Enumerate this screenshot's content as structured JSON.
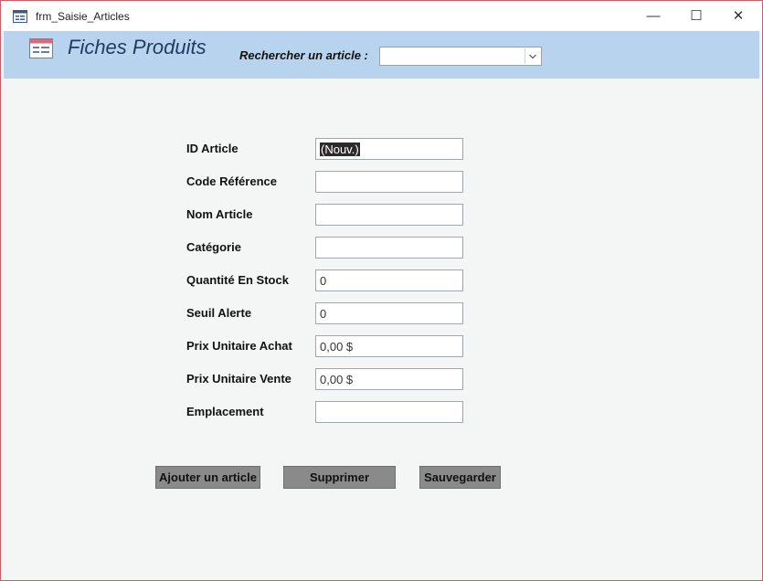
{
  "window": {
    "title": "frm_Saisie_Articles",
    "controls": {
      "minimize": "—",
      "maximize": "☐",
      "close": "✕"
    }
  },
  "header": {
    "title": "Fiches Produits",
    "search_label": "Rechercher un article :",
    "search_value": "",
    "background": "#b8d3ee"
  },
  "fields": [
    {
      "label": "ID Article",
      "value": "(Nouv.)",
      "selected": true
    },
    {
      "label": "Code Référence",
      "value": ""
    },
    {
      "label": "Nom Article",
      "value": ""
    },
    {
      "label": "Catégorie",
      "value": ""
    },
    {
      "label": "Quantité En Stock",
      "value": "0"
    },
    {
      "label": "Seuil Alerte",
      "value": "0"
    },
    {
      "label": "Prix Unitaire Achat",
      "value": "0,00 $"
    },
    {
      "label": "Prix Unitaire Vente",
      "value": "0,00 $"
    },
    {
      "label": "Emplacement",
      "value": ""
    }
  ],
  "buttons": {
    "add": "Ajouter un article",
    "delete": "Supprimer",
    "save": "Sauvegarder"
  },
  "icons": {
    "app": "form-icon",
    "header": "form-icon",
    "combo": "chevron-down-icon"
  }
}
